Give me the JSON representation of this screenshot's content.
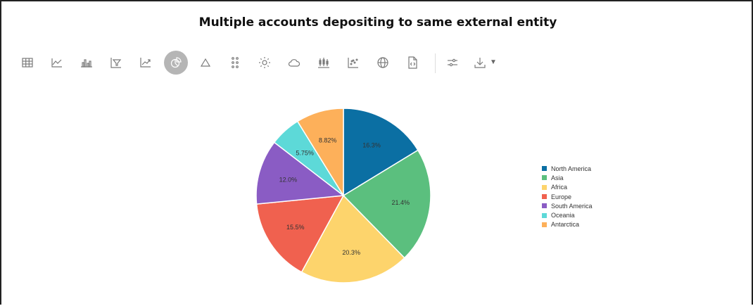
{
  "title": "Multiple accounts depositing to same external entity",
  "toolbar": {
    "icons": [
      "table-icon",
      "line-chart-icon",
      "bar-chart-icon",
      "funnel-icon",
      "area-chart-icon",
      "pie-chart-icon",
      "triangle-icon",
      "dot-grid-icon",
      "sun-icon",
      "cloud-icon",
      "box-plot-icon",
      "scatter-icon",
      "globe-icon",
      "code-file-icon",
      "settings-sliders-icon",
      "download-icon"
    ],
    "active": "pie-chart-icon"
  },
  "chart_data": {
    "type": "pie",
    "labels": [
      "North America",
      "Asia",
      "Africa",
      "Europe",
      "South America",
      "Oceania",
      "Antarctica"
    ],
    "values": [
      16.3,
      21.4,
      20.3,
      15.5,
      12.0,
      5.75,
      8.82
    ],
    "value_labels": [
      "16.3%",
      "21.4%",
      "20.3%",
      "15.5%",
      "12.0%",
      "5.75%",
      "8.82%"
    ],
    "colors": [
      "#0b6fa3",
      "#5bbf7e",
      "#fdd46c",
      "#f0614f",
      "#8a5cc4",
      "#5dd9d8",
      "#fdb05a"
    ],
    "legend_position": "right"
  }
}
